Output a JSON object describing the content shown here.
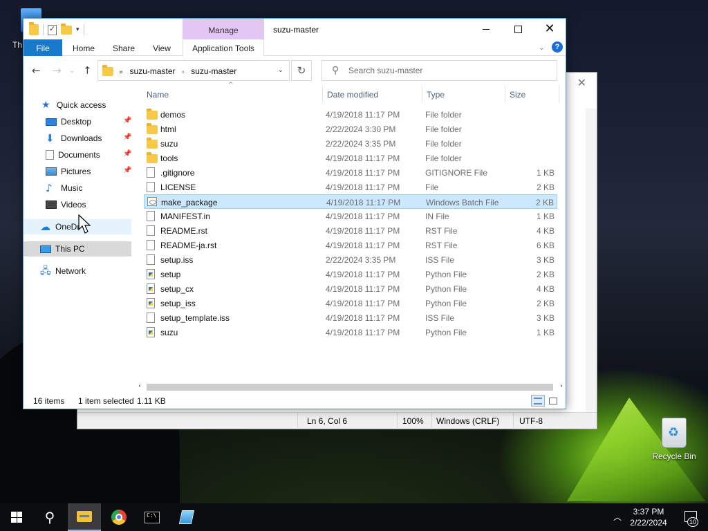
{
  "desktop": {
    "partial_icon_label": "Th",
    "recycle_bin_label": "Recycle Bin"
  },
  "notepad": {
    "status": {
      "position": "Ln 6, Col 6",
      "zoom": "100%",
      "line_ending": "Windows (CRLF)",
      "encoding": "UTF-8"
    }
  },
  "explorer": {
    "title": "suzu-master",
    "contextual_group": "Manage",
    "ribbon_tabs": {
      "file": "File",
      "home": "Home",
      "share": "Share",
      "view": "View",
      "application_tools": "Application Tools"
    },
    "address": {
      "overflow": "«",
      "crumbs": [
        "suzu-master",
        "suzu-master"
      ]
    },
    "search_placeholder": "Search suzu-master",
    "nav": {
      "quick_access": "Quick access",
      "desktop": "Desktop",
      "downloads": "Downloads",
      "documents": "Documents",
      "pictures": "Pictures",
      "music": "Music",
      "videos": "Videos",
      "onedrive": "OneDr",
      "this_pc": "This PC",
      "network": "Network"
    },
    "columns": {
      "name": "Name",
      "date": "Date modified",
      "type": "Type",
      "size": "Size"
    },
    "files": [
      {
        "name": "demos",
        "date": "4/19/2018 11:17 PM",
        "type": "File folder",
        "size": "",
        "icon": "folder-icon"
      },
      {
        "name": "html",
        "date": "2/22/2024 3:30 PM",
        "type": "File folder",
        "size": "",
        "icon": "folder-icon"
      },
      {
        "name": "suzu",
        "date": "2/22/2024 3:35 PM",
        "type": "File folder",
        "size": "",
        "icon": "folder-icon"
      },
      {
        "name": "tools",
        "date": "4/19/2018 11:17 PM",
        "type": "File folder",
        "size": "",
        "icon": "folder-icon"
      },
      {
        "name": ".gitignore",
        "date": "4/19/2018 11:17 PM",
        "type": "GITIGNORE File",
        "size": "1 KB",
        "icon": "file-icon"
      },
      {
        "name": "LICENSE",
        "date": "4/19/2018 11:17 PM",
        "type": "File",
        "size": "2 KB",
        "icon": "file-icon"
      },
      {
        "name": "make_package",
        "date": "4/19/2018 11:17 PM",
        "type": "Windows Batch File",
        "size": "2 KB",
        "icon": "batch-file-icon"
      },
      {
        "name": "MANIFEST.in",
        "date": "4/19/2018 11:17 PM",
        "type": "IN File",
        "size": "1 KB",
        "icon": "file-icon"
      },
      {
        "name": "README.rst",
        "date": "4/19/2018 11:17 PM",
        "type": "RST File",
        "size": "4 KB",
        "icon": "file-icon"
      },
      {
        "name": "README-ja.rst",
        "date": "4/19/2018 11:17 PM",
        "type": "RST File",
        "size": "6 KB",
        "icon": "file-icon"
      },
      {
        "name": "setup.iss",
        "date": "2/22/2024 3:35 PM",
        "type": "ISS File",
        "size": "3 KB",
        "icon": "file-icon"
      },
      {
        "name": "setup",
        "date": "4/19/2018 11:17 PM",
        "type": "Python File",
        "size": "2 KB",
        "icon": "python-file-icon"
      },
      {
        "name": "setup_cx",
        "date": "4/19/2018 11:17 PM",
        "type": "Python File",
        "size": "4 KB",
        "icon": "python-file-icon"
      },
      {
        "name": "setup_iss",
        "date": "4/19/2018 11:17 PM",
        "type": "Python File",
        "size": "2 KB",
        "icon": "python-file-icon"
      },
      {
        "name": "setup_template.iss",
        "date": "4/19/2018 11:17 PM",
        "type": "ISS File",
        "size": "3 KB",
        "icon": "file-icon"
      },
      {
        "name": "suzu",
        "date": "4/19/2018 11:17 PM",
        "type": "Python File",
        "size": "1 KB",
        "icon": "python-file-icon"
      }
    ],
    "selected_file": "make_package",
    "status": {
      "item_count": "16 items",
      "selection": "1 item selected",
      "selection_size": "1.11 KB"
    }
  },
  "taskbar": {
    "time": "3:37 PM",
    "date": "2/22/2024",
    "notification_count": "10"
  },
  "colors": {
    "accent": "#1979ca",
    "selection_bg": "#cce8ff",
    "selection_border": "#99d1ff",
    "manage_tab": "#e4c6f4"
  }
}
